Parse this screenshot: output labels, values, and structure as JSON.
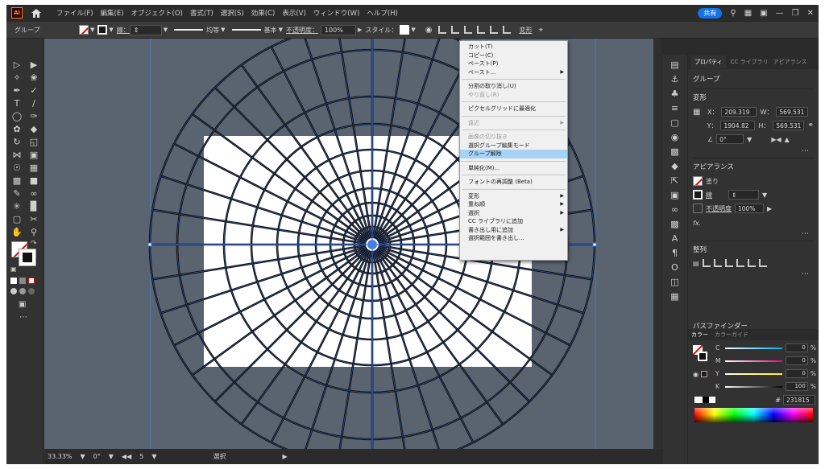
{
  "menubar": {
    "logo": "Ai",
    "items": [
      "ファイル(F)",
      "編集(E)",
      "オブジェクト(O)",
      "書式(T)",
      "選択(S)",
      "効果(C)",
      "表示(V)",
      "ウィンドウ(W)",
      "ヘルプ(H)"
    ],
    "share": "共有"
  },
  "control": {
    "label": "グループ",
    "stroke_label": "線：",
    "profile_label": "均等",
    "brush_label": "基本",
    "opacity_label": "不透明度：",
    "opacity_value": "100%",
    "style_label": "スタイル：",
    "transform_label": "変形"
  },
  "context_menu": {
    "items": [
      {
        "label": "カット(T)"
      },
      {
        "label": "コピー(C)"
      },
      {
        "label": "ペースト(P)"
      },
      {
        "label": "ペースト...",
        "submenu": true
      },
      {
        "sep": true
      },
      {
        "label": "分割の取り消し(U)"
      },
      {
        "label": "やり直し(R)",
        "disabled": true
      },
      {
        "sep": true
      },
      {
        "label": "ピクセルグリッドに最適化"
      },
      {
        "sep": true
      },
      {
        "label": "遠近",
        "disabled": true,
        "submenu": true
      },
      {
        "sep": true
      },
      {
        "label": "画像の切り抜き",
        "disabled": true
      },
      {
        "label": "選択グループ編集モード"
      },
      {
        "label": "グループ解除",
        "highlighted": true
      },
      {
        "sep": true
      },
      {
        "label": "単純化(M)..."
      },
      {
        "sep": true
      },
      {
        "label": "フォントの再調整 (Beta)"
      },
      {
        "sep": true
      },
      {
        "label": "変形",
        "submenu": true
      },
      {
        "label": "重ね順",
        "submenu": true
      },
      {
        "label": "選択",
        "submenu": true
      },
      {
        "label": "CC ライブラリに追加"
      },
      {
        "label": "書き出し用に追加",
        "submenu": true
      },
      {
        "label": "選択範囲を書き出し..."
      }
    ]
  },
  "properties": {
    "tabs": [
      "プロパティ",
      "CC ライブラリ",
      "アピアランス"
    ],
    "selection": "グループ",
    "transform_title": "変形",
    "x_label": "X：",
    "x_value": "209.319",
    "y_label": "Y：",
    "y_value": "1904.82",
    "w_label": "W：",
    "w_value": "569.531",
    "h_label": "H：",
    "h_value": "569.531",
    "angle_value": "0°",
    "appearance_title": "アピアランス",
    "fill_label": "塗り",
    "stroke_label": "線",
    "opacity_label": "不透明度",
    "opacity_value": "100%",
    "fx_label": "fx.",
    "align_title": "整列",
    "pathfinder_title": "パスファインダー"
  },
  "color": {
    "tabs": [
      "カラー",
      "カラーガイド"
    ],
    "sliders": [
      {
        "label": "C",
        "value": "0",
        "unit": "%"
      },
      {
        "label": "M",
        "value": "0",
        "unit": "%"
      },
      {
        "label": "Y",
        "value": "0",
        "unit": "%"
      },
      {
        "label": "K",
        "value": "100",
        "unit": "%"
      }
    ],
    "hex_prefix": "#",
    "hex": "231815"
  },
  "status": {
    "zoom": "33.33%",
    "rotate": "0°",
    "artboard": "5",
    "tool": "選択"
  }
}
